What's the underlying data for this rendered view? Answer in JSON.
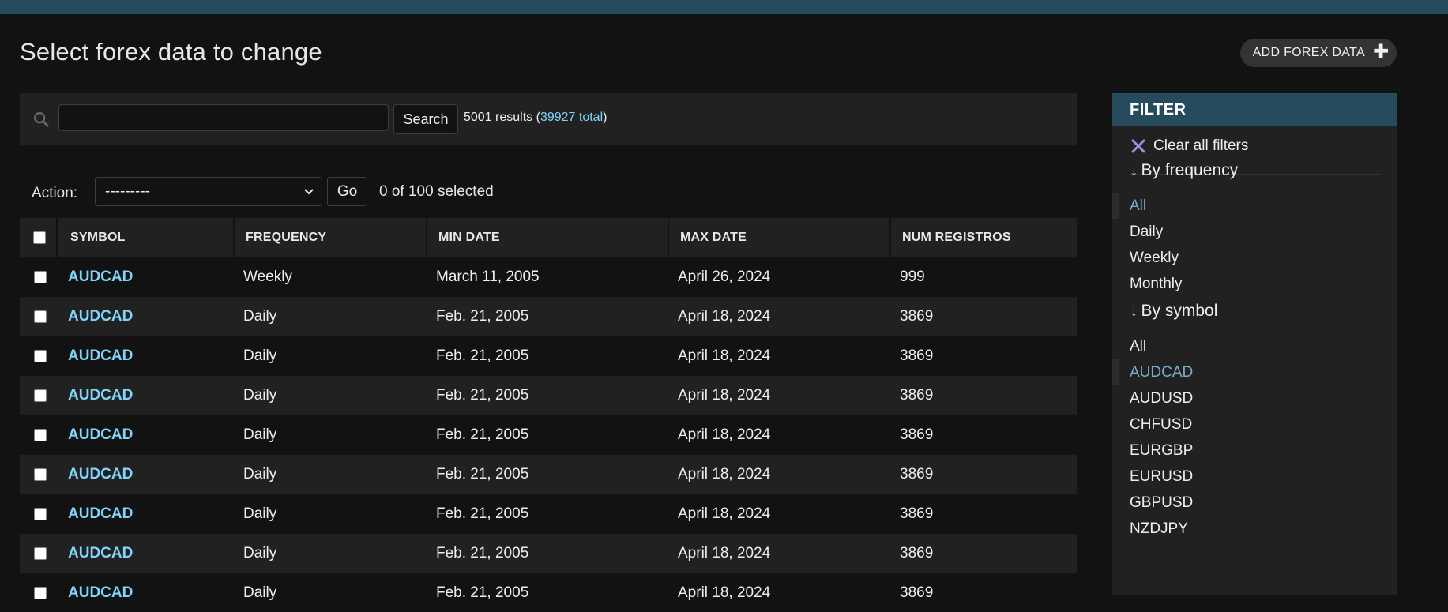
{
  "header": {
    "title": "Select forex data to change",
    "add_button": "ADD FOREX DATA",
    "add_icon": "plus-icon"
  },
  "search": {
    "value": "",
    "placeholder": "",
    "button": "Search",
    "result_count": "5001 results (",
    "total_link": "39927 total",
    "result_suffix": ")"
  },
  "actions": {
    "label": "Action:",
    "selected_value": "---------",
    "go_button": "Go",
    "selected_count": "0 of 100 selected"
  },
  "table": {
    "columns": [
      "SYMBOL",
      "FREQUENCY",
      "MIN DATE",
      "MAX DATE",
      "NUM REGISTROS"
    ],
    "rows": [
      {
        "symbol": "AUDCAD",
        "frequency": "Weekly",
        "min_date": "March 11, 2005",
        "max_date": "April 26, 2024",
        "num_registros": "999"
      },
      {
        "symbol": "AUDCAD",
        "frequency": "Daily",
        "min_date": "Feb. 21, 2005",
        "max_date": "April 18, 2024",
        "num_registros": "3869"
      },
      {
        "symbol": "AUDCAD",
        "frequency": "Daily",
        "min_date": "Feb. 21, 2005",
        "max_date": "April 18, 2024",
        "num_registros": "3869"
      },
      {
        "symbol": "AUDCAD",
        "frequency": "Daily",
        "min_date": "Feb. 21, 2005",
        "max_date": "April 18, 2024",
        "num_registros": "3869"
      },
      {
        "symbol": "AUDCAD",
        "frequency": "Daily",
        "min_date": "Feb. 21, 2005",
        "max_date": "April 18, 2024",
        "num_registros": "3869"
      },
      {
        "symbol": "AUDCAD",
        "frequency": "Daily",
        "min_date": "Feb. 21, 2005",
        "max_date": "April 18, 2024",
        "num_registros": "3869"
      },
      {
        "symbol": "AUDCAD",
        "frequency": "Daily",
        "min_date": "Feb. 21, 2005",
        "max_date": "April 18, 2024",
        "num_registros": "3869"
      },
      {
        "symbol": "AUDCAD",
        "frequency": "Daily",
        "min_date": "Feb. 21, 2005",
        "max_date": "April 18, 2024",
        "num_registros": "3869"
      },
      {
        "symbol": "AUDCAD",
        "frequency": "Daily",
        "min_date": "Feb. 21, 2005",
        "max_date": "April 18, 2024",
        "num_registros": "3869"
      }
    ]
  },
  "filter": {
    "header": "FILTER",
    "clear_all": "Clear all filters",
    "clear_icon": "close-icon",
    "by_frequency": {
      "title": "By frequency",
      "options": [
        "All",
        "Daily",
        "Weekly",
        "Monthly"
      ],
      "selected": "All"
    },
    "by_symbol": {
      "title": "By symbol",
      "options": [
        "All",
        "AUDCAD",
        "AUDUSD",
        "CHFUSD",
        "EURGBP",
        "EURUSD",
        "GBPUSD",
        "NZDJPY"
      ],
      "selected": "AUDCAD"
    }
  },
  "colors": {
    "header_bar": "#264b5d",
    "link": "#81d4fa",
    "selected_filter": "#79aec8",
    "background": "#121212",
    "panel": "#212121",
    "clear_icon": "#a78bdf"
  }
}
